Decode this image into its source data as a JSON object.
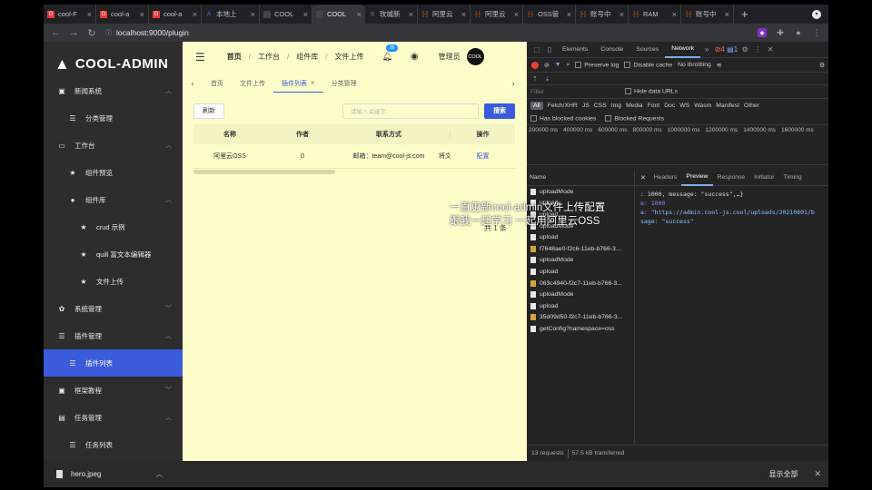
{
  "browser": {
    "tabs": [
      {
        "label": "cool-F",
        "icon": "G",
        "color": "#e53935"
      },
      {
        "label": "cool-a",
        "icon": "G",
        "color": "#e53935"
      },
      {
        "label": "cool-a",
        "icon": "G",
        "color": "#e53935"
      },
      {
        "label": "本地上",
        "icon": "A",
        "color": "#4f7df0"
      },
      {
        "label": "COOL",
        "icon": "",
        "color": "#444"
      },
      {
        "label": "COOL",
        "icon": "",
        "color": "#444"
      },
      {
        "label": "玫城新",
        "icon": "◎",
        "color": "#888"
      },
      {
        "label": "阿里云",
        "icon": "[-]",
        "color": "#ff6a00"
      },
      {
        "label": "阿里云",
        "icon": "[-]",
        "color": "#ff6a00"
      },
      {
        "label": "OSS管",
        "icon": "[-]",
        "color": "#ff6a00"
      },
      {
        "label": "账号中",
        "icon": "[-]",
        "color": "#ff6a00"
      },
      {
        "label": "RAM",
        "icon": "[-]",
        "color": "#ff6a00"
      },
      {
        "label": "账号中",
        "icon": "[-]",
        "color": "#ff6a00"
      }
    ],
    "active_tab_index": 5,
    "url": "localhost:9000/plugin"
  },
  "app": {
    "logo": "COOL-ADMIN",
    "sidebar": [
      {
        "label": "新闻系统",
        "icon": "▣",
        "level": 0,
        "arrow": "︿",
        "active": false
      },
      {
        "label": "分类管理",
        "icon": "☰",
        "level": 1,
        "arrow": "",
        "active": false
      },
      {
        "label": "工作台",
        "icon": "▭",
        "level": 0,
        "arrow": "︿",
        "active": false
      },
      {
        "label": "组件预览",
        "icon": "★",
        "level": 1,
        "arrow": "",
        "active": false
      },
      {
        "label": "组件库",
        "icon": "●",
        "level": 1,
        "arrow": "︿",
        "active": false
      },
      {
        "label": "crud 示例",
        "icon": "★",
        "level": 2,
        "arrow": "",
        "active": false
      },
      {
        "label": "quill 富文本编辑器",
        "icon": "★",
        "level": 2,
        "arrow": "",
        "active": false
      },
      {
        "label": "文件上传",
        "icon": "★",
        "level": 2,
        "arrow": "",
        "active": false
      },
      {
        "label": "系统管理",
        "icon": "✿",
        "level": 0,
        "arrow": "﹀",
        "active": false
      },
      {
        "label": "插件管理",
        "icon": "☰",
        "level": 0,
        "arrow": "︿",
        "active": false
      },
      {
        "label": "插件列表",
        "icon": "☰",
        "level": 1,
        "arrow": "",
        "active": true
      },
      {
        "label": "框架教程",
        "icon": "▣",
        "level": 0,
        "arrow": "﹀",
        "active": false
      },
      {
        "label": "任务管理",
        "icon": "▤",
        "level": 0,
        "arrow": "︿",
        "active": false
      },
      {
        "label": "任务列表",
        "icon": "☰",
        "level": 1,
        "arrow": "",
        "active": false
      }
    ],
    "breadcrumb": [
      "首页",
      "工作台",
      "组件库",
      "文件上传"
    ],
    "notification_count": "26",
    "user": "管理员",
    "avatar_text": "COOL",
    "page_tabs": [
      {
        "label": "首页",
        "active": false,
        "closable": false
      },
      {
        "label": "文件上传",
        "active": false,
        "closable": false
      },
      {
        "label": "插件列表",
        "active": true,
        "closable": true
      },
      {
        "label": "分类管理",
        "active": false,
        "closable": false
      }
    ],
    "refresh_label": "刷新",
    "search_placeholder": "请输入关键字",
    "search_label": "搜索",
    "table": {
      "headers": [
        "名称",
        "作者",
        "联系方式",
        "",
        "操作"
      ],
      "rows": [
        {
          "name": "阿里云OSS",
          "author": "0",
          "contact": "邮箱：team@cool-js.com",
          "extra": "将文",
          "action": "配置"
        }
      ]
    },
    "pagination": "共 1 条"
  },
  "devtools": {
    "tabs": [
      "Elements",
      "Console",
      "Sources",
      "Network"
    ],
    "active_tab": "Network",
    "errors": "4",
    "messages": "1",
    "preserve_log": "Preserve log",
    "disable_cache": "Disable cache",
    "throttling": "No throttling",
    "filter_placeholder": "Filter",
    "hide_data_urls": "Hide data URLs",
    "types": [
      "All",
      "Fetch/XHR",
      "JS",
      "CSS",
      "Img",
      "Media",
      "Font",
      "Doc",
      "WS",
      "Wasm",
      "Manifest",
      "Other"
    ],
    "has_blocked_cookies": "Has blocked cookies",
    "blocked_requests": "Blocked Requests",
    "timeline_ticks": [
      "200000 ms",
      "400000 ms",
      "600000 ms",
      "800000 ms",
      "1000000 ms",
      "1200000 ms",
      "1400000 ms",
      "1600000 ms"
    ],
    "name_header": "Name",
    "requests": [
      {
        "name": "uploadMode",
        "type": "doc"
      },
      {
        "name": "upload",
        "type": "doc"
      },
      {
        "name": "upload",
        "type": "doc"
      },
      {
        "name": "uploadMode",
        "type": "doc"
      },
      {
        "name": "upload",
        "type": "doc"
      },
      {
        "name": "f7648ae0-f2c6-11eb-b766-3...",
        "type": "img"
      },
      {
        "name": "uploadMode",
        "type": "doc"
      },
      {
        "name": "upload",
        "type": "doc"
      },
      {
        "name": "063c4940-f2c7-11eb-b766-3...",
        "type": "img"
      },
      {
        "name": "uploadMode",
        "type": "doc"
      },
      {
        "name": "upload",
        "type": "doc"
      },
      {
        "name": "35d09d50-f2c7-11eb-b766-3...",
        "type": "img"
      },
      {
        "name": "getConfig?namespace=oss",
        "type": "doc"
      }
    ],
    "detail_tabs": [
      "Headers",
      "Preview",
      "Response",
      "Initiator",
      "Timing"
    ],
    "active_detail_tab": "Preview",
    "preview_lines": [
      ": 1000, message: \"success\",…}",
      "e: 1000",
      "a: \"https://admin.cool-js.cool/uploads/20210801/b",
      "sage: \"success\""
    ],
    "status_requests": "13 requests",
    "status_transferred": "57.5 kB transferred"
  },
  "subtitle": {
    "line1": "一直更新cool-admin文件上传配置",
    "line2": "跟我一起学习 一起用阿里云OSS"
  },
  "download": {
    "filename": "hero.jpeg",
    "show_all": "显示全部"
  }
}
